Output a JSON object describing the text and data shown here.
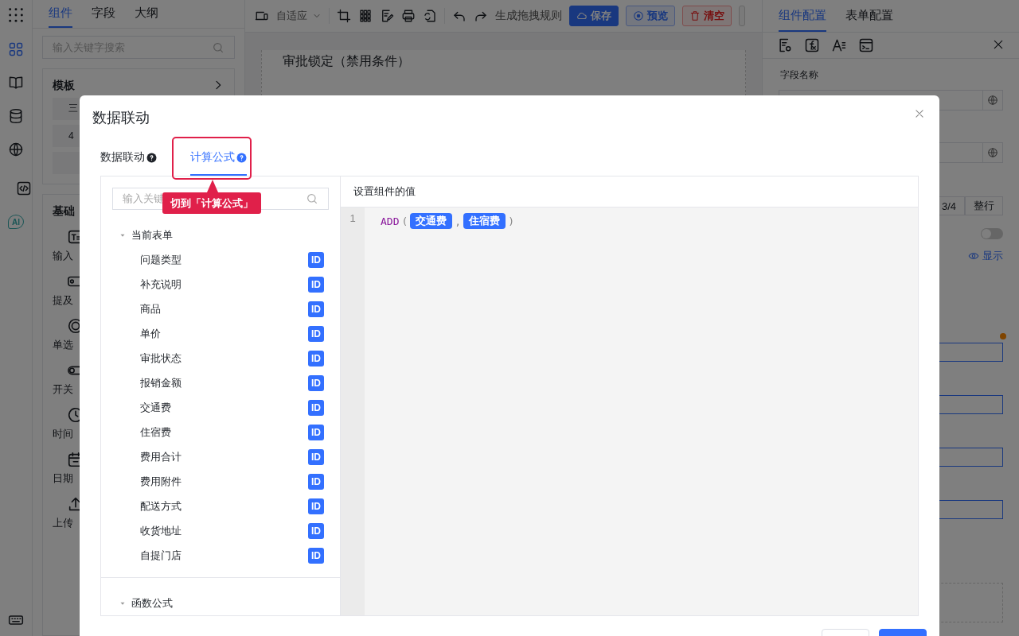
{
  "rail": {
    "items": [
      {
        "kind": "grid",
        "selected": true
      },
      {
        "kind": "book",
        "selected": false
      },
      {
        "kind": "database",
        "selected": false
      },
      {
        "kind": "globe",
        "selected": false
      },
      {
        "kind": "code",
        "selected": false
      },
      {
        "kind": "ai",
        "label": "AI",
        "selected": false
      }
    ]
  },
  "left_panel": {
    "tabs": [
      {
        "label": "组件",
        "selected": true
      },
      {
        "label": "字段",
        "selected": false
      },
      {
        "label": "大纲",
        "selected": false
      }
    ],
    "search": {
      "placeholder": "输入关键字搜索"
    },
    "template_card": {
      "title": "模板",
      "items": [
        "三",
        "4"
      ]
    },
    "basic_card": {
      "title": "基础",
      "items": [
        {
          "kind": "text",
          "label": "输入"
        },
        {
          "kind": "mention",
          "label": "提及"
        },
        {
          "kind": "radio",
          "label": "单选"
        },
        {
          "kind": "switch",
          "label": "开关"
        },
        {
          "kind": "time",
          "label": "时间"
        },
        {
          "kind": "date",
          "label": "日期"
        },
        {
          "kind": "upload",
          "label": "上传"
        }
      ]
    }
  },
  "toolbar": {
    "device_select": "自适应",
    "rule_button": "生成拖拽规则",
    "buttons": [
      {
        "kind": "primary",
        "label": "保存"
      },
      {
        "kind": "outline",
        "label": "预览"
      },
      {
        "kind": "danger",
        "label": "清空"
      }
    ]
  },
  "canvas": {
    "field_title": "审批锁定（禁用条件）"
  },
  "right_panel": {
    "tabs": [
      {
        "label": "组件配置",
        "selected": true
      },
      {
        "label": "表单配置",
        "selected": false
      }
    ],
    "field_label": "字段名称",
    "segments": [
      "3/4",
      "整行"
    ],
    "toggle": {
      "on": false
    },
    "visibility_link": "显示"
  },
  "dialog": {
    "title": "数据联动",
    "tabs": [
      {
        "label": "数据联动",
        "selected": false
      },
      {
        "label": "计算公式",
        "selected": true
      }
    ],
    "callout": "切到「计算公式」",
    "search": {
      "placeholder": "输入关键"
    },
    "tree": [
      {
        "label": "当前表单",
        "expanded": true,
        "children": [
          {
            "label": "问题类型",
            "badge": "ID"
          },
          {
            "label": "补充说明",
            "badge": "ID"
          },
          {
            "label": "商品",
            "badge": "ID"
          },
          {
            "label": "单价",
            "badge": "ID"
          },
          {
            "label": "审批状态",
            "badge": "ID"
          },
          {
            "label": "报销金额",
            "badge": "ID"
          },
          {
            "label": "交通费",
            "badge": "ID"
          },
          {
            "label": "住宿费",
            "badge": "ID"
          },
          {
            "label": "费用合计",
            "badge": "ID"
          },
          {
            "label": "费用附件",
            "badge": "ID"
          },
          {
            "label": "配送方式",
            "badge": "ID"
          },
          {
            "label": "收货地址",
            "badge": "ID"
          },
          {
            "label": "自提门店",
            "badge": "ID"
          }
        ]
      },
      {
        "label": "函数公式",
        "expanded": true
      }
    ],
    "editor": {
      "header": "设置组件的值",
      "line_number": "1",
      "tokens": [
        {
          "kind": "fn",
          "text": "ADD"
        },
        {
          "kind": "punct",
          "text": "("
        },
        {
          "kind": "tag",
          "text": "交通费"
        },
        {
          "kind": "punct",
          "text": ","
        },
        {
          "kind": "tag",
          "text": "住宿费"
        },
        {
          "kind": "punct",
          "text": ")"
        }
      ]
    }
  }
}
